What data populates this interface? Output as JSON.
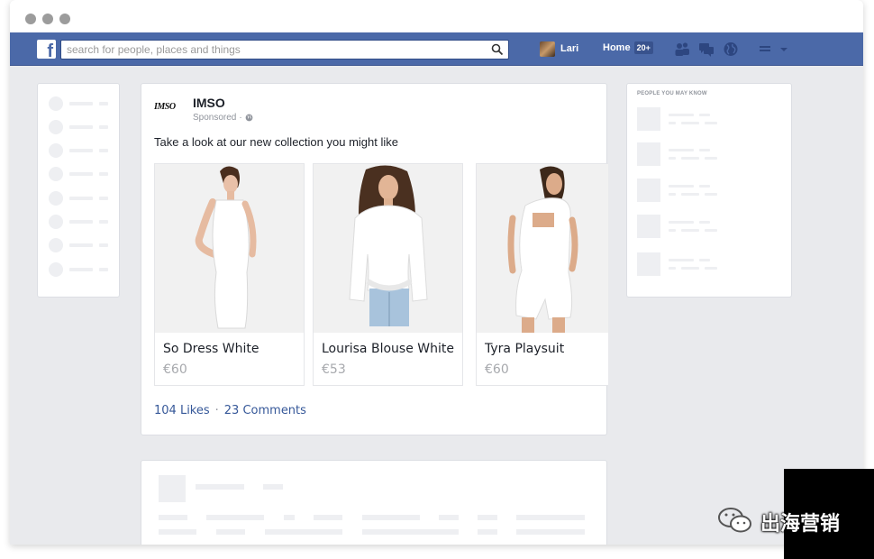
{
  "search": {
    "placeholder": "search for people, places and things"
  },
  "profile": {
    "name": "Lari"
  },
  "nav": {
    "home_label": "Home",
    "home_badge": "20+"
  },
  "right_panel": {
    "heading": "PEOPLE YOU MAY KNOW"
  },
  "post": {
    "brand_logo_text": "IMSO",
    "brand_name": "IMSO",
    "sponsored": "Sponsored",
    "sponsored_sep": "·",
    "text": "Take a look at our new collection you might like",
    "products": [
      {
        "title": "So Dress White",
        "price": "€60"
      },
      {
        "title": "Lourisa Blouse White",
        "price": "€53"
      },
      {
        "title": "Tyra Playsuit",
        "price": "€60"
      }
    ],
    "likes": "104 Likes",
    "stats_sep": "·",
    "comments": "23 Comments"
  },
  "watermark": {
    "text": "出海营销"
  },
  "colors": {
    "facebook_blue": "#4b69a8",
    "link_blue": "#365899",
    "page_bg": "#e9eaed"
  },
  "icons": [
    "facebook-logo-icon",
    "search-icon",
    "friend-requests-icon",
    "messages-icon",
    "notifications-globe-icon",
    "settings-icon",
    "chevron-down-icon",
    "globe-icon",
    "wechat-icon"
  ]
}
